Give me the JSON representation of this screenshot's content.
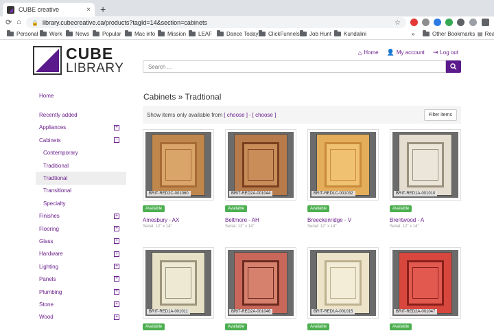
{
  "browser": {
    "tab_title": "CUBE creative",
    "tab_close": "×",
    "new_tab": "+",
    "url": "library.cubecreative.ca/products?tagId=14&section=cabinets",
    "bookmarks": [
      "Personal",
      "Work",
      "News",
      "Popular",
      "Mac info",
      "Mission",
      "LEAF",
      "Dance Today",
      "ClickFunnels",
      "Job Hunt",
      "Kundalini"
    ],
    "more": "»",
    "other_bookmarks": "Other Bookmarks",
    "reading": "Rea"
  },
  "header": {
    "logo_top": "CUBE",
    "logo_bottom": "LIBRARY",
    "links": {
      "home": "Home",
      "account": "My account",
      "logout": "Log out"
    },
    "search_placeholder": "Search ..."
  },
  "sidebar": {
    "home": "Home",
    "recent": "Recently added",
    "items": [
      {
        "label": "Appliances",
        "toggle": "+"
      },
      {
        "label": "Cabinets",
        "toggle": "−"
      }
    ],
    "sub_items": [
      "Contemporary",
      "Traditional",
      "Tradtional",
      "Transitional",
      "Specialty"
    ],
    "active_sub": 2,
    "more_items": [
      {
        "label": "Finishes",
        "toggle": "+"
      },
      {
        "label": "Flooring",
        "toggle": "+"
      },
      {
        "label": "Glass",
        "toggle": "+"
      },
      {
        "label": "Hardware",
        "toggle": "+"
      },
      {
        "label": "Lighting",
        "toggle": "+"
      },
      {
        "label": "Panels",
        "toggle": "+"
      },
      {
        "label": "Plumbing",
        "toggle": "+"
      },
      {
        "label": "Stone",
        "toggle": "+"
      },
      {
        "label": "Wood",
        "toggle": "+"
      }
    ]
  },
  "main": {
    "title": "Cabinets » Tradtional",
    "filter_text": "Show items only available from",
    "choose": "[ choose ]",
    "dash": "-",
    "filter_button": "Filter items",
    "products": [
      {
        "code": "BRIT-RED2C-001060",
        "status": "Available",
        "name": "Amesbury - AX",
        "serial": "Serial: 12\" x 14\"",
        "colors": [
          "#c0874c",
          "#a86a35",
          "#d9a569"
        ]
      },
      {
        "code": "BRIT-RED2A-001044",
        "status": "Available",
        "name": "Beltmore - AH",
        "serial": "Serial: 12\" x 14\"",
        "colors": [
          "#b77a4a",
          "#7a3f1e",
          "#c98d5a"
        ]
      },
      {
        "code": "BRIT-RED1C-001032",
        "status": "Available",
        "name": "Breeckenridge - V",
        "serial": "Serial: 12\" x 14\"",
        "colors": [
          "#e3ad5a",
          "#c98a3c",
          "#efc170"
        ]
      },
      {
        "code": "BRIT-RED1A-001010",
        "status": "Available",
        "name": "Brentwood - A",
        "serial": "Serial: 12\" x 14\"",
        "colors": [
          "#e4ddd0",
          "#9b8f7d",
          "#ece6da"
        ]
      },
      {
        "code": "BRIT-RED1A-001011",
        "status": "Available",
        "name": "",
        "serial": "",
        "colors": [
          "#e6e0c6",
          "#9c957c",
          "#eee9d2"
        ]
      },
      {
        "code": "BRIT-RED2A-001046",
        "status": "Available",
        "name": "",
        "serial": "",
        "colors": [
          "#c9685a",
          "#6b2a1f",
          "#d6816d"
        ]
      },
      {
        "code": "BRIT-RED1A-001015",
        "status": "Available",
        "name": "",
        "serial": "",
        "colors": [
          "#ece3c8",
          "#bdb08f",
          "#f3ecd6"
        ]
      },
      {
        "code": "BRIT-RED2A-001047",
        "status": "Available",
        "name": "",
        "serial": "",
        "colors": [
          "#d7473d",
          "#8a1f1a",
          "#e25a4f"
        ]
      }
    ]
  }
}
